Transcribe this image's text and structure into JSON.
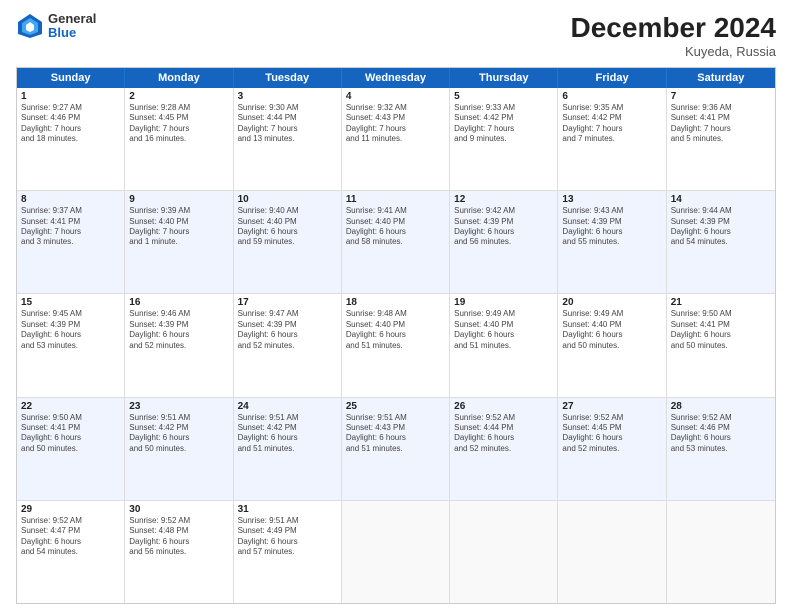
{
  "header": {
    "logo": {
      "general": "General",
      "blue": "Blue"
    },
    "title": "December 2024",
    "location": "Kuyeda, Russia"
  },
  "weekdays": [
    "Sunday",
    "Monday",
    "Tuesday",
    "Wednesday",
    "Thursday",
    "Friday",
    "Saturday"
  ],
  "rows": [
    {
      "alt": false,
      "cells": [
        {
          "day": "1",
          "lines": [
            "Sunrise: 9:27 AM",
            "Sunset: 4:46 PM",
            "Daylight: 7 hours",
            "and 18 minutes."
          ]
        },
        {
          "day": "2",
          "lines": [
            "Sunrise: 9:28 AM",
            "Sunset: 4:45 PM",
            "Daylight: 7 hours",
            "and 16 minutes."
          ]
        },
        {
          "day": "3",
          "lines": [
            "Sunrise: 9:30 AM",
            "Sunset: 4:44 PM",
            "Daylight: 7 hours",
            "and 13 minutes."
          ]
        },
        {
          "day": "4",
          "lines": [
            "Sunrise: 9:32 AM",
            "Sunset: 4:43 PM",
            "Daylight: 7 hours",
            "and 11 minutes."
          ]
        },
        {
          "day": "5",
          "lines": [
            "Sunrise: 9:33 AM",
            "Sunset: 4:42 PM",
            "Daylight: 7 hours",
            "and 9 minutes."
          ]
        },
        {
          "day": "6",
          "lines": [
            "Sunrise: 9:35 AM",
            "Sunset: 4:42 PM",
            "Daylight: 7 hours",
            "and 7 minutes."
          ]
        },
        {
          "day": "7",
          "lines": [
            "Sunrise: 9:36 AM",
            "Sunset: 4:41 PM",
            "Daylight: 7 hours",
            "and 5 minutes."
          ]
        }
      ]
    },
    {
      "alt": true,
      "cells": [
        {
          "day": "8",
          "lines": [
            "Sunrise: 9:37 AM",
            "Sunset: 4:41 PM",
            "Daylight: 7 hours",
            "and 3 minutes."
          ]
        },
        {
          "day": "9",
          "lines": [
            "Sunrise: 9:39 AM",
            "Sunset: 4:40 PM",
            "Daylight: 7 hours",
            "and 1 minute."
          ]
        },
        {
          "day": "10",
          "lines": [
            "Sunrise: 9:40 AM",
            "Sunset: 4:40 PM",
            "Daylight: 6 hours",
            "and 59 minutes."
          ]
        },
        {
          "day": "11",
          "lines": [
            "Sunrise: 9:41 AM",
            "Sunset: 4:40 PM",
            "Daylight: 6 hours",
            "and 58 minutes."
          ]
        },
        {
          "day": "12",
          "lines": [
            "Sunrise: 9:42 AM",
            "Sunset: 4:39 PM",
            "Daylight: 6 hours",
            "and 56 minutes."
          ]
        },
        {
          "day": "13",
          "lines": [
            "Sunrise: 9:43 AM",
            "Sunset: 4:39 PM",
            "Daylight: 6 hours",
            "and 55 minutes."
          ]
        },
        {
          "day": "14",
          "lines": [
            "Sunrise: 9:44 AM",
            "Sunset: 4:39 PM",
            "Daylight: 6 hours",
            "and 54 minutes."
          ]
        }
      ]
    },
    {
      "alt": false,
      "cells": [
        {
          "day": "15",
          "lines": [
            "Sunrise: 9:45 AM",
            "Sunset: 4:39 PM",
            "Daylight: 6 hours",
            "and 53 minutes."
          ]
        },
        {
          "day": "16",
          "lines": [
            "Sunrise: 9:46 AM",
            "Sunset: 4:39 PM",
            "Daylight: 6 hours",
            "and 52 minutes."
          ]
        },
        {
          "day": "17",
          "lines": [
            "Sunrise: 9:47 AM",
            "Sunset: 4:39 PM",
            "Daylight: 6 hours",
            "and 52 minutes."
          ]
        },
        {
          "day": "18",
          "lines": [
            "Sunrise: 9:48 AM",
            "Sunset: 4:40 PM",
            "Daylight: 6 hours",
            "and 51 minutes."
          ]
        },
        {
          "day": "19",
          "lines": [
            "Sunrise: 9:49 AM",
            "Sunset: 4:40 PM",
            "Daylight: 6 hours",
            "and 51 minutes."
          ]
        },
        {
          "day": "20",
          "lines": [
            "Sunrise: 9:49 AM",
            "Sunset: 4:40 PM",
            "Daylight: 6 hours",
            "and 50 minutes."
          ]
        },
        {
          "day": "21",
          "lines": [
            "Sunrise: 9:50 AM",
            "Sunset: 4:41 PM",
            "Daylight: 6 hours",
            "and 50 minutes."
          ]
        }
      ]
    },
    {
      "alt": true,
      "cells": [
        {
          "day": "22",
          "lines": [
            "Sunrise: 9:50 AM",
            "Sunset: 4:41 PM",
            "Daylight: 6 hours",
            "and 50 minutes."
          ]
        },
        {
          "day": "23",
          "lines": [
            "Sunrise: 9:51 AM",
            "Sunset: 4:42 PM",
            "Daylight: 6 hours",
            "and 50 minutes."
          ]
        },
        {
          "day": "24",
          "lines": [
            "Sunrise: 9:51 AM",
            "Sunset: 4:42 PM",
            "Daylight: 6 hours",
            "and 51 minutes."
          ]
        },
        {
          "day": "25",
          "lines": [
            "Sunrise: 9:51 AM",
            "Sunset: 4:43 PM",
            "Daylight: 6 hours",
            "and 51 minutes."
          ]
        },
        {
          "day": "26",
          "lines": [
            "Sunrise: 9:52 AM",
            "Sunset: 4:44 PM",
            "Daylight: 6 hours",
            "and 52 minutes."
          ]
        },
        {
          "day": "27",
          "lines": [
            "Sunrise: 9:52 AM",
            "Sunset: 4:45 PM",
            "Daylight: 6 hours",
            "and 52 minutes."
          ]
        },
        {
          "day": "28",
          "lines": [
            "Sunrise: 9:52 AM",
            "Sunset: 4:46 PM",
            "Daylight: 6 hours",
            "and 53 minutes."
          ]
        }
      ]
    },
    {
      "alt": false,
      "cells": [
        {
          "day": "29",
          "lines": [
            "Sunrise: 9:52 AM",
            "Sunset: 4:47 PM",
            "Daylight: 6 hours",
            "and 54 minutes."
          ]
        },
        {
          "day": "30",
          "lines": [
            "Sunrise: 9:52 AM",
            "Sunset: 4:48 PM",
            "Daylight: 6 hours",
            "and 56 minutes."
          ]
        },
        {
          "day": "31",
          "lines": [
            "Sunrise: 9:51 AM",
            "Sunset: 4:49 PM",
            "Daylight: 6 hours",
            "and 57 minutes."
          ]
        },
        null,
        null,
        null,
        null
      ]
    }
  ]
}
